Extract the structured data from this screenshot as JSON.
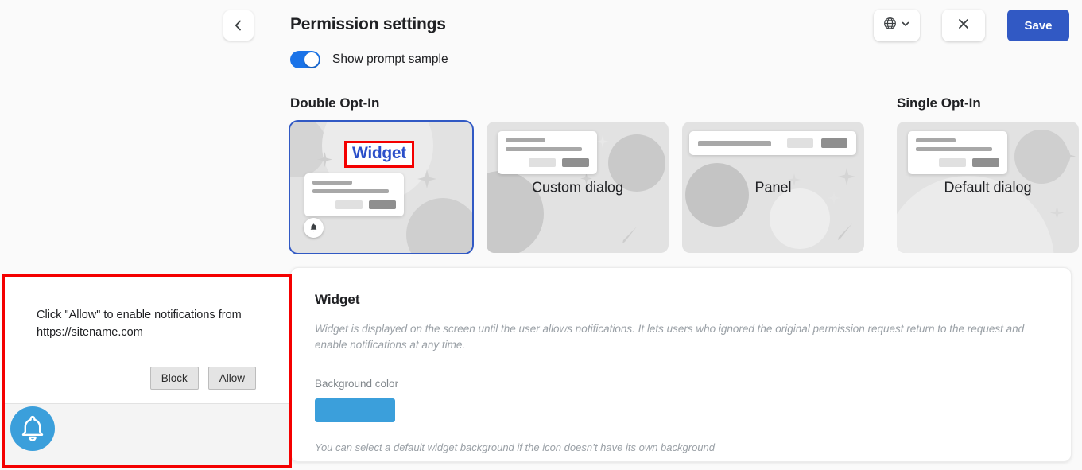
{
  "header": {
    "back_label": "chevron-left",
    "title": "Permission settings",
    "toggle_label": "Show prompt sample",
    "toggle_on": true,
    "language_icon": "globe-icon",
    "close_icon": "close-icon",
    "save_label": "Save",
    "save_color": "#3159c4"
  },
  "sections": {
    "double_opt_in": "Double Opt-In",
    "single_opt_in": "Single Opt-In"
  },
  "cards": [
    {
      "label": "Widget",
      "selected": true,
      "highlight_color": "#f40000",
      "label_color": "#2b4fc9"
    },
    {
      "label": "Custom dialog",
      "selected": false
    },
    {
      "label": "Panel",
      "selected": false
    },
    {
      "label": "Default dialog",
      "selected": false
    }
  ],
  "detail": {
    "title": "Widget",
    "description": "Widget is displayed on the screen until the user allows notifications. It lets users who ignored the original permission request return to the request and enable notifications at any time.",
    "background_color_label": "Background color",
    "background_color_value": "#3b9fdb",
    "hint": "You can select a default widget background if the icon doesn’t have its own background"
  },
  "prompt_sample": {
    "message": "Click \"Allow\" to enable notifications from https://sitename.com",
    "block_label": "Block",
    "allow_label": "Allow",
    "bell_icon": "bell-icon",
    "bell_color": "#3b9fdb",
    "border_color": "#f40000"
  }
}
